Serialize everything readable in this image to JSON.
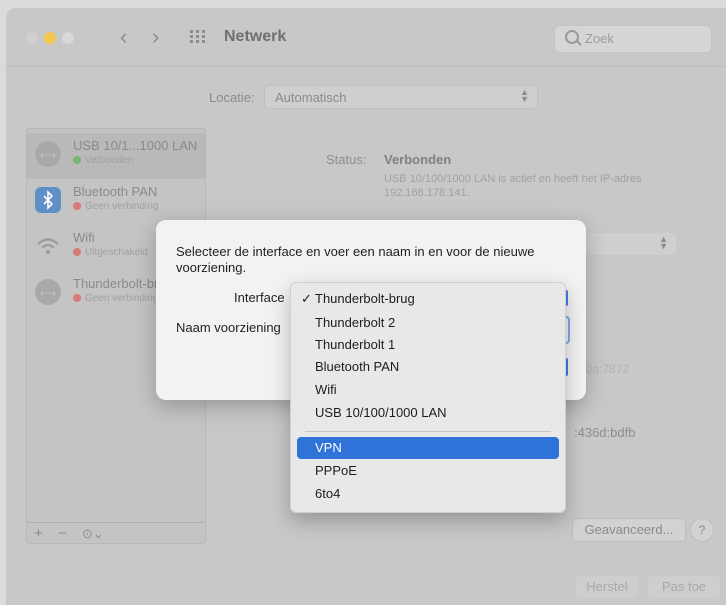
{
  "window": {
    "title": "Netwerk"
  },
  "toolbar": {
    "back_label": "‹",
    "forward_label": "›",
    "search_placeholder": "Zoek"
  },
  "location": {
    "label": "Locatie:",
    "value": "Automatisch"
  },
  "sidebar": {
    "items": [
      {
        "name": "USB 10/1...1000 LAN",
        "status": "Verbonden",
        "status_color": "#70b774"
      },
      {
        "name": "Bluetooth PAN",
        "status": "Geen verbinding",
        "status_color": "#d77a7a"
      },
      {
        "name": "Wifi",
        "status": "Uitgeschakeld",
        "status_color": "#d77a7a"
      },
      {
        "name": "Thunderbolt-brug",
        "status": "Geen verbinding",
        "status_color": "#d77a7a"
      }
    ],
    "footer": {
      "add": "+",
      "remove": "−",
      "actions": "⊙⌄"
    }
  },
  "details": {
    "status_label": "Status:",
    "status_value": "Verbonden",
    "status_description": "USB 10/100/1000 LAN is actief en heeft het IP-adres 192.168.178.141.",
    "fragment_ipv6": "e0a:7872",
    "fragment_router": ":436d:bdfb",
    "advanced_button": "Geavanceerd...",
    "help_button": "?",
    "revert_button": "Herstel",
    "apply_button": "Pas toe"
  },
  "dialog": {
    "message": "Selecteer de interface en voer een naam in en voor de nieuwe voorziening.",
    "interface_label": "Interface",
    "service_name_label": "Naam voorziening"
  },
  "menu": {
    "selected": "Thunderbolt-brug",
    "checkmark": "✓",
    "highlighted": "VPN",
    "groups": [
      [
        "Thunderbolt-brug",
        "Thunderbolt 2",
        "Thunderbolt 1",
        "Bluetooth PAN",
        "Wifi",
        "USB 10/100/1000 LAN"
      ],
      [
        "VPN",
        "PPPoE",
        "6to4"
      ]
    ]
  },
  "colors": {
    "accent": "#2f73d9",
    "traffic_yellow": "#f2c94c"
  }
}
